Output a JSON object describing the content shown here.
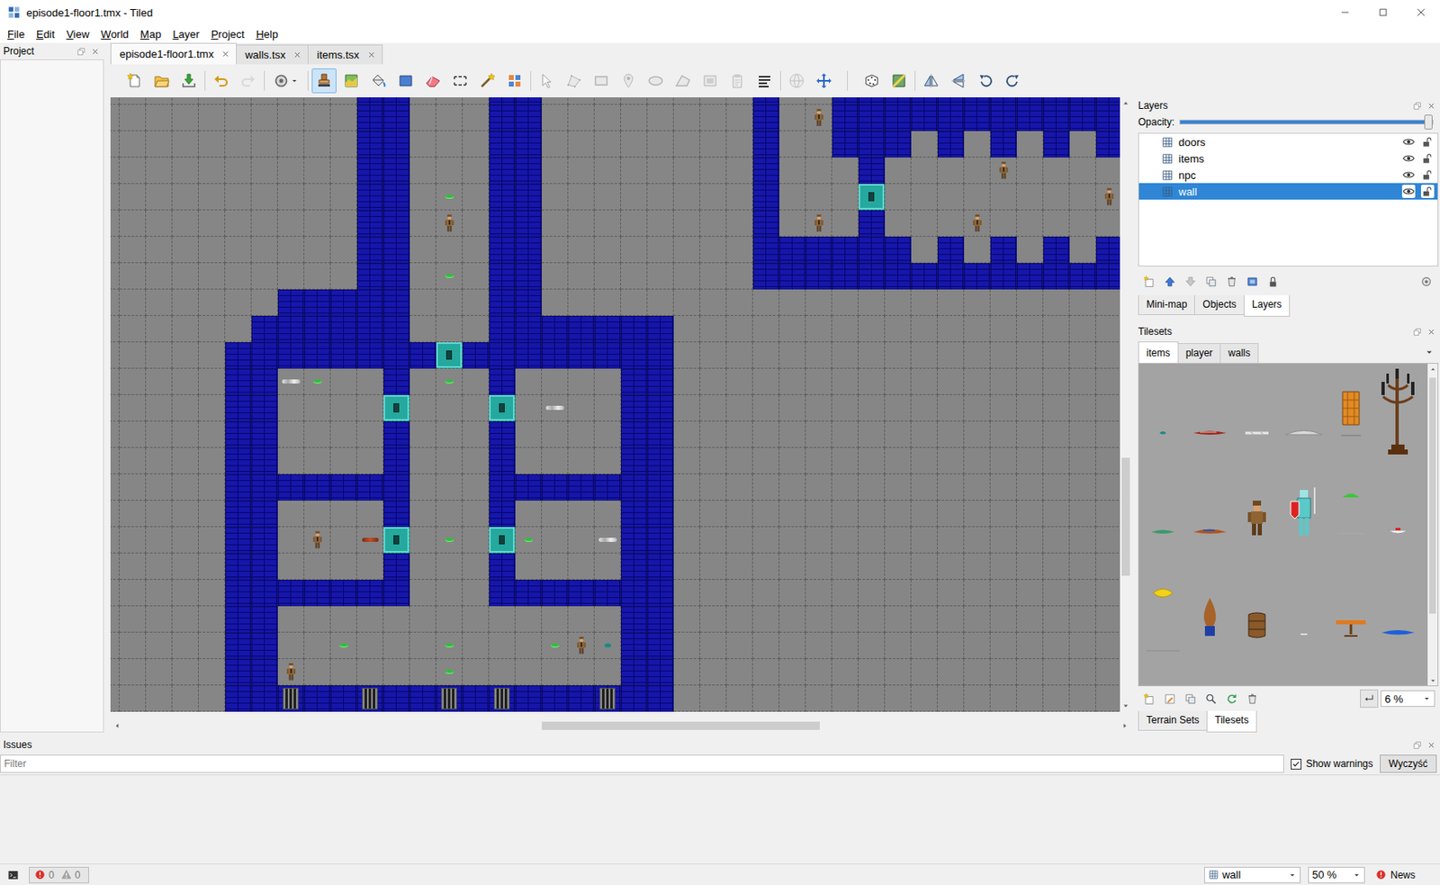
{
  "window": {
    "title": "episode1-floor1.tmx - Tiled"
  },
  "menu": [
    "File",
    "Edit",
    "View",
    "World",
    "Map",
    "Layer",
    "Project",
    "Help"
  ],
  "project_panel": {
    "title": "Project"
  },
  "document_tabs": [
    {
      "label": "episode1-floor1.tmx",
      "selected": true
    },
    {
      "label": "walls.tsx",
      "selected": false
    },
    {
      "label": "items.tsx",
      "selected": false
    }
  ],
  "toolbar": [
    [
      {
        "kind": "new",
        "selected": false,
        "disabled": false
      },
      {
        "kind": "open",
        "selected": false,
        "disabled": false
      },
      {
        "kind": "save",
        "selected": false,
        "disabled": false
      }
    ],
    [
      {
        "kind": "undo",
        "selected": false,
        "disabled": false
      },
      {
        "kind": "redo",
        "selected": false,
        "disabled": true
      }
    ],
    [
      {
        "kind": "commands",
        "selected": false,
        "disabled": false
      }
    ],
    [
      {
        "kind": "stamp",
        "selected": true,
        "disabled": false
      },
      {
        "kind": "terrain",
        "selected": false,
        "disabled": false
      },
      {
        "kind": "bucket",
        "selected": false,
        "disabled": false
      },
      {
        "kind": "shapefill",
        "selected": false,
        "disabled": false
      },
      {
        "kind": "eraser",
        "selected": false,
        "disabled": false
      },
      {
        "kind": "rectsel",
        "selected": false,
        "disabled": false
      },
      {
        "kind": "wand",
        "selected": false,
        "disabled": false
      },
      {
        "kind": "sametile",
        "selected": false,
        "disabled": false
      }
    ],
    [
      {
        "kind": "selectobj",
        "selected": false,
        "disabled": true
      },
      {
        "kind": "editpoly",
        "selected": false,
        "disabled": true
      },
      {
        "kind": "insertrect",
        "selected": false,
        "disabled": true
      },
      {
        "kind": "point",
        "selected": false,
        "disabled": true
      },
      {
        "kind": "ellipse",
        "selected": false,
        "disabled": true
      },
      {
        "kind": "polygon",
        "selected": false,
        "disabled": true
      },
      {
        "kind": "tileobj",
        "selected": false,
        "disabled": true
      },
      {
        "kind": "template",
        "selected": false,
        "disabled": true
      },
      {
        "kind": "text",
        "selected": false,
        "disabled": false
      }
    ],
    [
      {
        "kind": "world",
        "selected": false,
        "disabled": true
      },
      {
        "kind": "move",
        "selected": false,
        "disabled": false
      }
    ],
    [
      {
        "kind": "random",
        "selected": false,
        "disabled": false
      },
      {
        "kind": "wang",
        "selected": false,
        "disabled": false
      }
    ],
    [
      {
        "kind": "fliph",
        "selected": false,
        "disabled": false
      },
      {
        "kind": "flipv",
        "selected": false,
        "disabled": false
      },
      {
        "kind": "rotl",
        "selected": false,
        "disabled": false
      },
      {
        "kind": "rotr",
        "selected": false,
        "disabled": false
      }
    ]
  ],
  "map": {
    "rows": [
      "..........WW...WW........W..WWWWWWWWWWW",
      "..........WW...WW........W.NWWWWWWWWWWW",
      "..........WW...WW........W..WWW.W.W.W.W",
      "..........WW...WW........W...W....N....",
      "..........WW.g.WW........W...D........N",
      "..........WW.N.WW........W.N.W...N.....",
      "..........WW...WW........WWWWWW.W.W.W.W",
      "..........WW.g.WW........WWWWWWWWWWWWWW",
      ".......WWWWW...WW......................",
      "......WWWWWW...WWWWWWW.................",
      ".....WWWWWWWWDWWWWWWWW.................",
      ".....WWbg..W.g.W....WW.................",
      ".....WW....D...D.b..WW.................",
      ".....WW....W...W....WW.................",
      ".....WW....W...W....WW.................",
      ".....WWWWWWW...WWWWWWW.................",
      ".....WW....W...W....WW.................",
      ".....WW.N.rD.g.Dg..bWW.................",
      ".....WW....W...W....WW.................",
      ".....WWWWWWW...WWWWWWW.................",
      ".....WW.............WW.................",
      ".....WW..g...g...gNtWW.................",
      ".....WWN.....g......WW.................",
      ".....WWGWWGWWGWGWWWGWW................."
    ]
  },
  "h_scroll": {
    "start": 0.42,
    "size": 0.28
  },
  "v_scroll": {
    "start": 0.59,
    "size": 0.2
  },
  "layers_panel": {
    "title": "Layers",
    "opacity_label": "Opacity:",
    "opacity": 1,
    "layers": [
      {
        "name": "doors",
        "visible": true,
        "locked": false,
        "selected": false
      },
      {
        "name": "items",
        "visible": true,
        "locked": false,
        "selected": false
      },
      {
        "name": "npc",
        "visible": true,
        "locked": false,
        "selected": false
      },
      {
        "name": "wall",
        "visible": true,
        "locked": false,
        "selected": true
      }
    ],
    "tabs": [
      {
        "label": "Mini-map",
        "selected": false
      },
      {
        "label": "Objects",
        "selected": false
      },
      {
        "label": "Layers",
        "selected": true
      }
    ]
  },
  "tilesets_panel": {
    "title": "Tilesets",
    "tabs": [
      {
        "label": "items",
        "selected": true
      },
      {
        "label": "player",
        "selected": false
      },
      {
        "label": "walls",
        "selected": false
      }
    ],
    "tiles": [
      {
        "kind": "teal-blob"
      },
      {
        "kind": "blood"
      },
      {
        "kind": "bones"
      },
      {
        "kind": "bone-pile"
      },
      {
        "kind": "cage"
      },
      {
        "kind": "chandelier"
      },
      {
        "kind": "puddle-green"
      },
      {
        "kind": "dead-guard"
      },
      {
        "kind": "guard"
      },
      {
        "kind": "knight"
      },
      {
        "kind": "ceiling-light"
      },
      {
        "kind": "food"
      },
      {
        "kind": "treasure"
      },
      {
        "kind": "plant"
      },
      {
        "kind": "barrel"
      },
      {
        "kind": "bone"
      },
      {
        "kind": "table"
      },
      {
        "kind": "water"
      }
    ],
    "scroll": {
      "start": 0.015,
      "size": 0.78
    },
    "zoom": "6 %",
    "bottom_tabs": [
      {
        "label": "Terrain Sets",
        "selected": false
      },
      {
        "label": "Tilesets",
        "selected": true
      }
    ]
  },
  "issues_panel": {
    "title": "Issues",
    "filter_placeholder": "Filter",
    "show_warnings": {
      "label": "Show warnings",
      "checked": true
    },
    "clear_button": "Wyczyść"
  },
  "status_bar": {
    "errors": "0",
    "warnings": "0",
    "layer": "wall",
    "zoom": "50 %",
    "news": "News"
  }
}
